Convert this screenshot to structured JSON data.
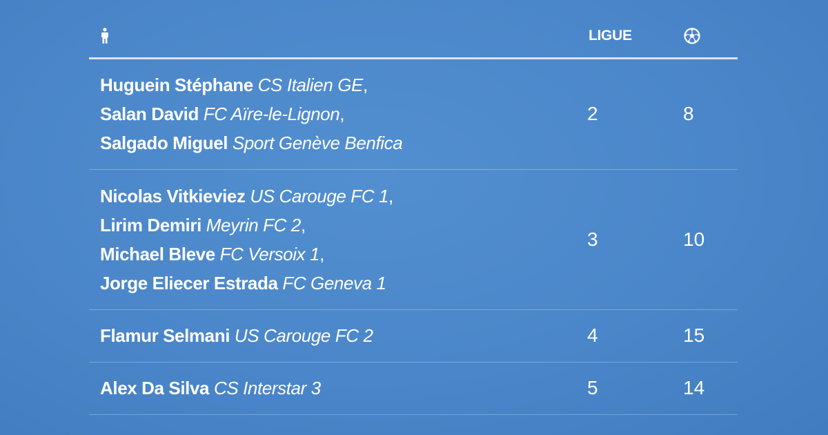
{
  "header": {
    "player_icon": "person-icon",
    "league_label": "LIGUE",
    "goals_icon": "soccer-ball-icon"
  },
  "rows": [
    {
      "players": [
        {
          "name": "Huguein Stéphane",
          "club": "CS Italien GE",
          "sep": ","
        },
        {
          "name": "Salan David",
          "club": "FC Aïre-le-Lignon",
          "sep": ","
        },
        {
          "name": "Salgado Miguel",
          "club": "Sport Genève Benfica",
          "sep": ""
        }
      ],
      "league": "2",
      "goals": "8"
    },
    {
      "players": [
        {
          "name": "Nicolas Vitkieviez",
          "club": "US Carouge FC 1",
          "sep": ","
        },
        {
          "name": "Lirim Demiri",
          "club": "Meyrin FC 2",
          "sep": ","
        },
        {
          "name": "Michael Bleve",
          "club": "FC Versoix 1",
          "sep": ","
        },
        {
          "name": "Jorge Eliecer Estrada",
          "club": "FC Geneva 1",
          "sep": ""
        }
      ],
      "league": "3",
      "goals": "10"
    },
    {
      "players": [
        {
          "name": "Flamur Selmani",
          "club": "US Carouge FC 2",
          "sep": ""
        }
      ],
      "league": "4",
      "goals": "15"
    },
    {
      "players": [
        {
          "name": "Alex Da Silva",
          "club": "CS Interstar 3",
          "sep": ""
        }
      ],
      "league": "5",
      "goals": "14"
    }
  ],
  "colors": {
    "background": "#4a86c9",
    "text": "#ffffff",
    "header_rule": "#dfe4ea"
  }
}
